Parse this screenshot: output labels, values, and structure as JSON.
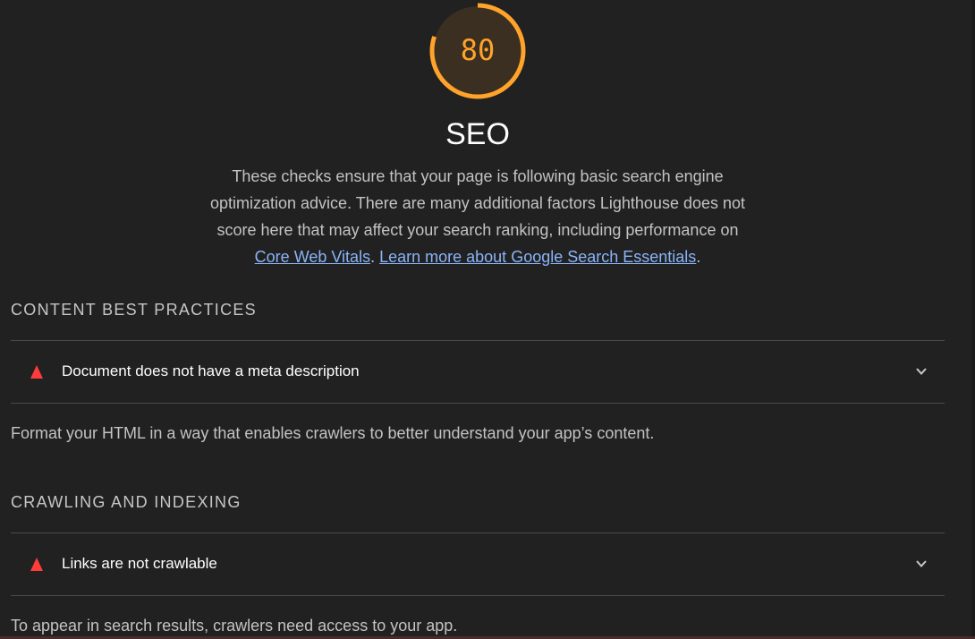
{
  "category": {
    "score": "80",
    "score_fraction": 0.8,
    "title": "SEO",
    "description_part1": "These checks ensure that your page is following basic search engine optimization advice. There are many additional factors Lighthouse does not score here that may affect your search ranking, including performance on ",
    "link_core_web_vitals": "Core Web Vitals",
    "separator": ". ",
    "link_learn_more": "Learn more about Google Search Essentials",
    "description_end": ".",
    "gauge_color": "#ffa32a"
  },
  "groups": [
    {
      "title": "CONTENT BEST PRACTICES",
      "audit_title": "Document does not have a meta description",
      "description": "Format your HTML in a way that enables crawlers to better understand your app’s content."
    },
    {
      "title": "CRAWLING AND INDEXING",
      "audit_title": "Links are not crawlable",
      "description": "To appear in search results, crawlers need access to your app."
    }
  ],
  "icons": {
    "fail": "fail-triangle-icon",
    "expand": "chevron-down-icon"
  },
  "colors": {
    "fail": "#ff3b3b",
    "link": "#8ab4f8",
    "background": "#212121"
  }
}
